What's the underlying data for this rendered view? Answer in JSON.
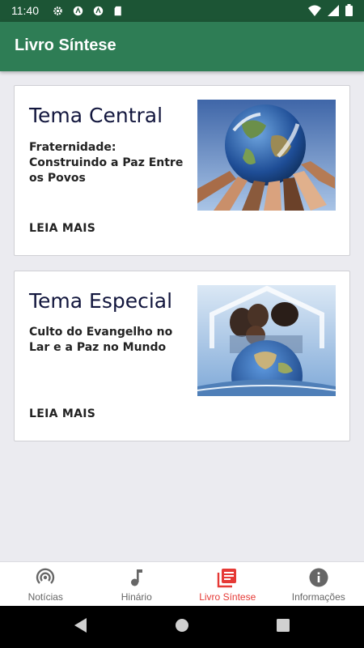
{
  "status_bar": {
    "time": "11:40"
  },
  "app_bar": {
    "title": "Livro Síntese"
  },
  "cards": [
    {
      "title": "Tema Central",
      "subtitle": "Fraternidade: Construindo a Paz Entre os Povos",
      "action": "LEIA MAIS",
      "image": "globe-held-by-hands"
    },
    {
      "title": "Tema Especial",
      "subtitle": "Culto do Evangelho no Lar e a Paz no Mundo",
      "action": "LEIA MAIS",
      "image": "family-over-globe"
    }
  ],
  "bottom_nav": {
    "active_index": 2,
    "active_color": "#e53935",
    "items": [
      {
        "label": "Notícias",
        "icon": "broadcast-icon"
      },
      {
        "label": "Hinário",
        "icon": "music-note-icon"
      },
      {
        "label": "Livro Síntese",
        "icon": "library-books-icon"
      },
      {
        "label": "Informações",
        "icon": "info-icon"
      }
    ]
  },
  "colors": {
    "app_bar": "#2e7d55",
    "status_bar": "#1c5535",
    "title_text": "#12163d"
  }
}
